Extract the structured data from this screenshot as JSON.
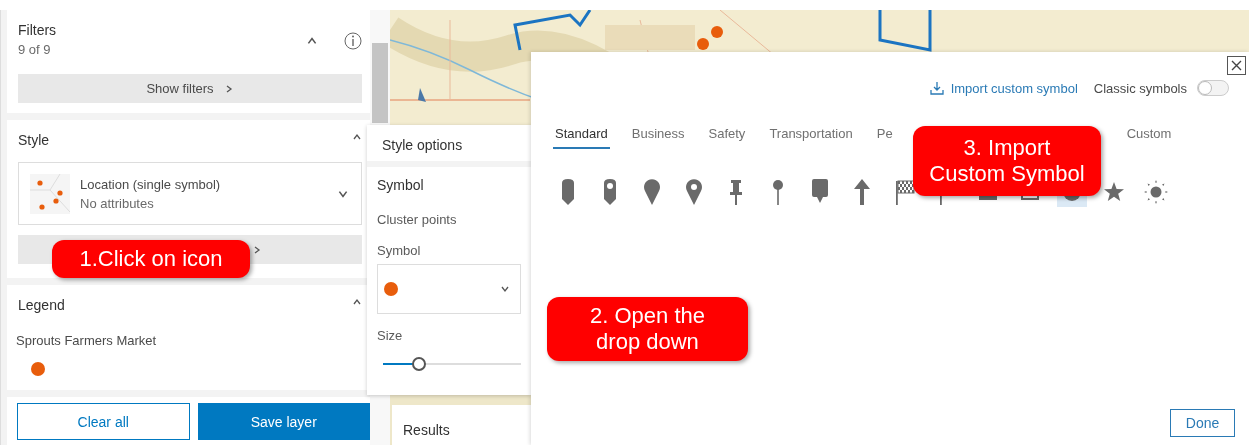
{
  "filters": {
    "title": "Filters",
    "count": "9 of 9",
    "expanded": true,
    "button": "Show filters"
  },
  "style": {
    "title": "Style",
    "expanded": true,
    "select": {
      "label": "Location (single symbol)",
      "sublabel": "No attributes"
    }
  },
  "legend": {
    "title": "Legend",
    "expanded": true,
    "item": "Sprouts Farmers Market",
    "color": "#e85d0c"
  },
  "footer": {
    "buttons": [
      {
        "label": "Clear all",
        "kind": "outline"
      },
      {
        "label": "Save layer",
        "kind": "primary"
      }
    ]
  },
  "style_options": {
    "title": "Style options",
    "section": "Symbol",
    "cluster": "Cluster points",
    "symbol": {
      "label": "Symbol",
      "color": "#e85d0c"
    },
    "size_label": "Size",
    "size": {
      "level": 0.26
    }
  },
  "results": {
    "title": "Results"
  },
  "symbol_dialog": {
    "import_link": "Import custom symbol",
    "classic": {
      "label": "Classic symbols",
      "on": false
    },
    "tabs": [
      {
        "label": "Standard",
        "selected": true
      },
      {
        "label": "Business",
        "selected": false
      },
      {
        "label": "Safety",
        "selected": false
      },
      {
        "label": "Transportation",
        "selected": false
      },
      {
        "label": "Pe",
        "selected": false
      },
      {
        "label": "Custom",
        "selected": false
      }
    ],
    "symbols": [
      {
        "kind": "marker-bar",
        "selected": false
      },
      {
        "kind": "marker-hole",
        "selected": false
      },
      {
        "kind": "pin",
        "selected": false
      },
      {
        "kind": "pin-hole",
        "selected": false
      },
      {
        "kind": "pushpin",
        "selected": false
      },
      {
        "kind": "round-pin",
        "selected": false
      },
      {
        "kind": "bubble",
        "selected": false
      },
      {
        "kind": "arrow",
        "selected": false
      },
      {
        "kind": "flag-checkered",
        "selected": false
      },
      {
        "kind": "flag",
        "selected": false
      },
      {
        "kind": "square",
        "selected": false
      },
      {
        "kind": "square-outline",
        "selected": false
      },
      {
        "kind": "circle",
        "selected": true
      },
      {
        "kind": "star",
        "selected": false
      },
      {
        "kind": "sun",
        "selected": false
      }
    ],
    "done": "Done"
  },
  "callouts": [
    {
      "text": "1.Click on icon"
    },
    {
      "text": "2. Open the\ndrop down"
    },
    {
      "text": "3. Import\nCustom Symbol"
    }
  ]
}
